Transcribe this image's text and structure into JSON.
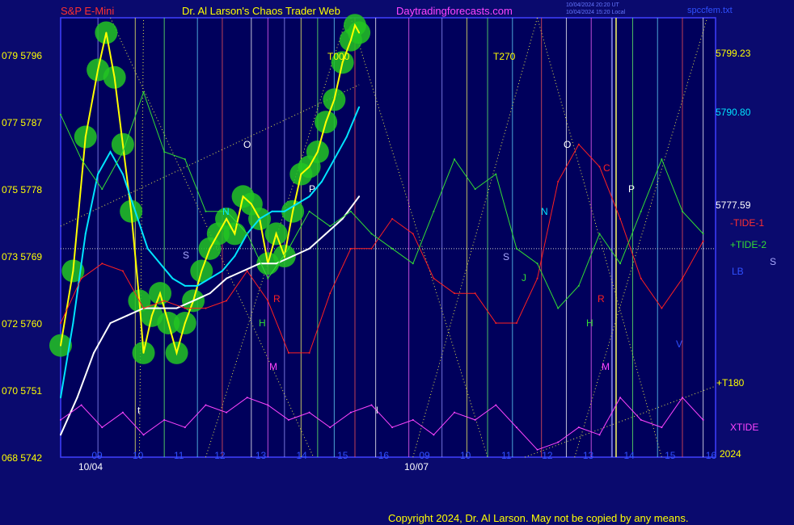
{
  "header": {
    "symbol": "S&P E-Mini",
    "title": "Dr. Al Larson's Chaos Trader Web",
    "site": "Daytradingforecasts.com",
    "stamp1": "10/04/2024 20:20 UT",
    "stamp2": "10/04/2024 15:20 Local",
    "file": "spccfem.txt"
  },
  "footer": {
    "copyright": "Copyright 2024, Dr. Al Larson. May not be copied by any means."
  },
  "colors": {
    "background": "#0a0a6e",
    "price": "#ffff00",
    "ema_fast": "#00e5ff",
    "ema_slow": "#ffffff",
    "tide1": "#ff2020",
    "tide2": "#33dd33",
    "xtide": "#ff44ff",
    "halo": "#22c422"
  },
  "chart_data": {
    "type": "line",
    "y_axis": {
      "range": [
        5742,
        5801
      ],
      "ticks": [
        {
          "prefix": "068",
          "value": 5742
        },
        {
          "prefix": "070",
          "value": 5751
        },
        {
          "prefix": "072",
          "value": 5760
        },
        {
          "prefix": "073",
          "value": 5769
        },
        {
          "prefix": "075",
          "value": 5778
        },
        {
          "prefix": "077",
          "value": 5787
        },
        {
          "prefix": "079",
          "value": 5796
        }
      ]
    },
    "x_axis": {
      "hours": [
        "09",
        "10",
        "11",
        "12",
        "13",
        "14",
        "15",
        "16",
        "09",
        "10",
        "11",
        "12",
        "13",
        "14",
        "15",
        "16"
      ],
      "dates": [
        "10/04",
        "10/07"
      ],
      "year": "2024"
    },
    "right_labels": {
      "high": "5799.23",
      "ema": "5790.80",
      "mid": "5777.59",
      "tide1": "-TIDE-1",
      "tide2": "+TIDE-2",
      "lb": "LB",
      "s": "S",
      "t180": "+T180",
      "xtide": "XTIDE"
    },
    "annotations": [
      "T000",
      "T270",
      "O",
      "N",
      "S",
      "J",
      "H",
      "R",
      "M",
      "P",
      "C",
      "t",
      "l",
      "V"
    ],
    "series": [
      {
        "name": "",
        "role": "price",
        "x": [
          0,
          0.3,
          0.6,
          0.9,
          1.1,
          1.3,
          1.5,
          1.7,
          1.9,
          2.0,
          2.2,
          2.4,
          2.6,
          2.8,
          3.0,
          3.2,
          3.4,
          3.6,
          3.8,
          4.0,
          4.2,
          4.4,
          4.6,
          4.8,
          5.0,
          5.2,
          5.4,
          5.6,
          5.8,
          6.0,
          6.2,
          6.4,
          6.6,
          6.8,
          7.0,
          7.1,
          7.2
        ],
        "y": [
          5757,
          5767,
          5785,
          5794,
          5799,
          5793,
          5784,
          5775,
          5763,
          5756,
          5761,
          5764,
          5760,
          5756,
          5760,
          5763,
          5767,
          5770,
          5772,
          5774,
          5772,
          5777,
          5776,
          5774,
          5768,
          5772,
          5769,
          5775,
          5780,
          5781,
          5783,
          5787,
          5790,
          5795,
          5798,
          5800,
          5799
        ]
      },
      {
        "name": "",
        "role": "fast-average",
        "x": [
          0,
          0.3,
          0.6,
          0.9,
          1.2,
          1.5,
          1.8,
          2.1,
          2.4,
          2.7,
          3.0,
          3.3,
          3.6,
          3.9,
          4.2,
          4.5,
          4.8,
          5.1,
          5.4,
          5.7,
          6.0,
          6.3,
          6.6,
          6.9,
          7.2
        ],
        "y": [
          5750,
          5760,
          5772,
          5780,
          5783,
          5780,
          5775,
          5770,
          5768,
          5766,
          5765,
          5765,
          5766,
          5767,
          5769,
          5772,
          5774,
          5775,
          5775,
          5776,
          5777,
          5779,
          5782,
          5785,
          5789
        ]
      },
      {
        "name": "",
        "role": "slow-average",
        "x": [
          0,
          0.4,
          0.8,
          1.2,
          1.6,
          2.0,
          2.4,
          2.8,
          3.2,
          3.6,
          4.0,
          4.4,
          4.8,
          5.2,
          5.6,
          6.0,
          6.4,
          6.8,
          7.2
        ],
        "y": [
          5745,
          5750,
          5756,
          5760,
          5761,
          5762,
          5762,
          5762,
          5763,
          5764,
          5766,
          5767,
          5768,
          5768,
          5769,
          5770,
          5772,
          5774,
          5777
        ]
      },
      {
        "name": "-TIDE-1",
        "role": "tide1",
        "x": [
          0,
          0.5,
          1.0,
          1.5,
          2.0,
          2.5,
          3.0,
          3.5,
          4.0,
          4.5,
          5.0,
          5.5,
          6.0,
          6.5,
          7.0,
          7.5,
          8.0,
          8.5,
          9.0,
          9.5,
          10.0,
          10.5,
          11.0,
          11.5,
          12.0,
          12.5,
          13.0,
          13.5,
          14.0,
          14.5,
          15.0,
          15.5
        ],
        "y": [
          5760,
          5766,
          5768,
          5767,
          5762,
          5763,
          5762,
          5762,
          5763,
          5767,
          5763,
          5756,
          5756,
          5764,
          5770,
          5770,
          5774,
          5772,
          5766,
          5764,
          5764,
          5760,
          5760,
          5766,
          5779,
          5784,
          5781,
          5774,
          5766,
          5762,
          5766,
          5771
        ]
      },
      {
        "name": "+TIDE-2",
        "role": "tide2",
        "x": [
          0,
          0.5,
          1.0,
          1.5,
          2.0,
          2.5,
          3.0,
          3.5,
          4.0,
          4.5,
          5.0,
          5.5,
          6.0,
          6.5,
          7.0,
          7.5,
          8.0,
          8.5,
          9.0,
          9.5,
          10.0,
          10.5,
          11.0,
          11.5,
          12.0,
          12.5,
          13.0,
          13.5,
          14.0,
          14.5,
          15.0,
          15.5
        ],
        "y": [
          5788,
          5782,
          5778,
          5783,
          5791,
          5783,
          5782,
          5775,
          5775,
          5772,
          5766,
          5770,
          5775,
          5773,
          5775,
          5772,
          5770,
          5768,
          5775,
          5782,
          5778,
          5780,
          5770,
          5768,
          5762,
          5765,
          5772,
          5768,
          5775,
          5782,
          5775,
          5772
        ]
      },
      {
        "name": "XTIDE",
        "role": "xtide",
        "x": [
          0,
          0.5,
          1.0,
          1.5,
          2.0,
          2.5,
          3.0,
          3.5,
          4.0,
          4.5,
          5.0,
          5.5,
          6.0,
          6.5,
          7.0,
          7.5,
          8.0,
          8.5,
          9.0,
          9.5,
          10.0,
          10.5,
          11.0,
          11.5,
          12.0,
          12.5,
          13.0,
          13.5,
          14.0,
          14.5,
          15.0,
          15.5
        ],
        "y": [
          5747,
          5749,
          5746,
          5748,
          5745,
          5747,
          5746,
          5749,
          5748,
          5750,
          5749,
          5747,
          5748,
          5746,
          5748,
          5749,
          5746,
          5747,
          5745,
          5748,
          5747,
          5749,
          5746,
          5743,
          5744,
          5746,
          5745,
          5750,
          5747,
          5746,
          5750,
          5747
        ]
      }
    ]
  }
}
